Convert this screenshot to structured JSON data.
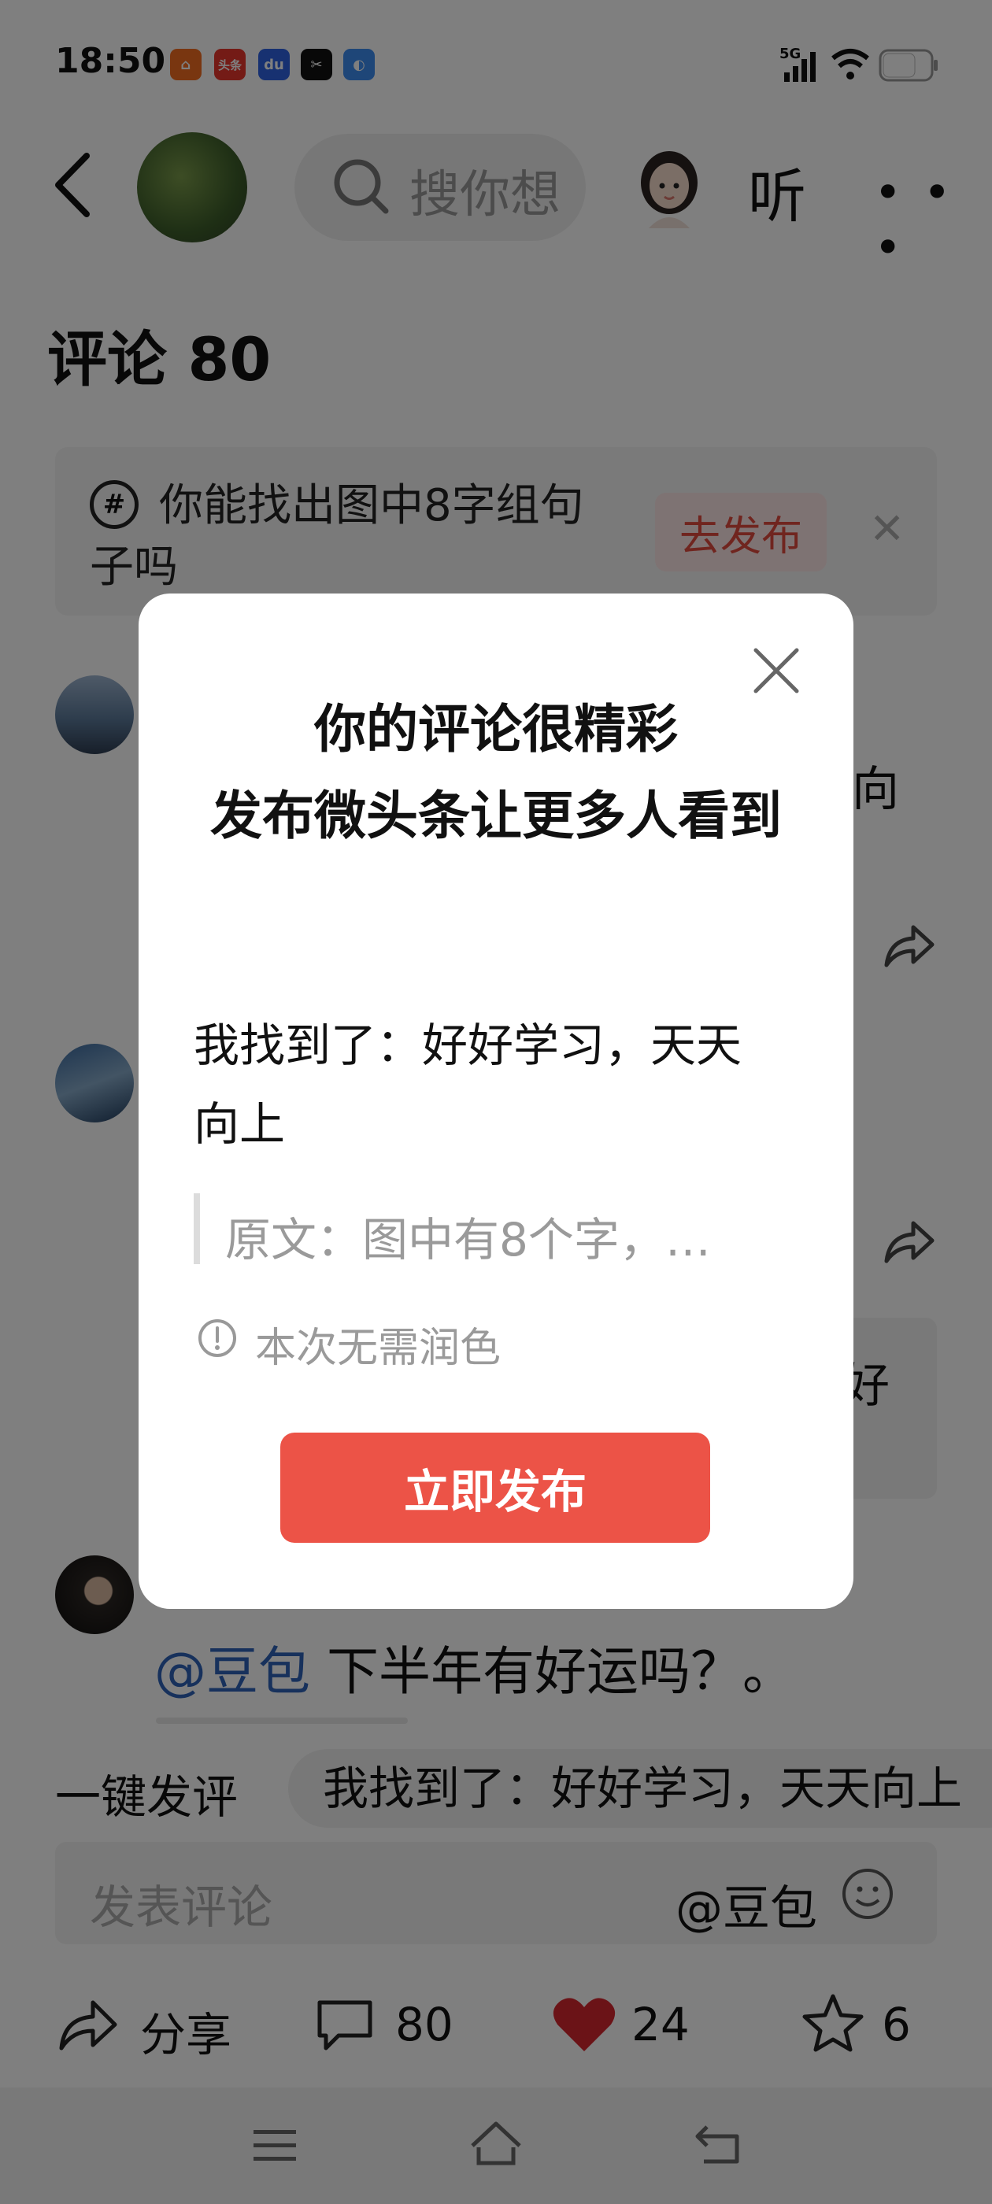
{
  "status_bar": {
    "time": "18:50",
    "network": "5G",
    "app_icons": [
      {
        "name": "orange-app-icon",
        "text": "",
        "color": "#f36d21"
      },
      {
        "name": "toutiao-app-icon",
        "text": "头条",
        "color": "#e8372c"
      },
      {
        "name": "baidu-app-icon",
        "text": "du",
        "color": "#2f63e3"
      },
      {
        "name": "capcut-app-icon",
        "text": "✂",
        "color": "#111111"
      },
      {
        "name": "files-app-icon",
        "text": "",
        "color": "#3c8cf0"
      }
    ]
  },
  "header": {
    "search_placeholder": "搜你想",
    "listen_label": "听"
  },
  "comments": {
    "title": "评论 80",
    "topic_card": {
      "text": "你能找出图中8字组句子吗",
      "publish_label": "去发布"
    },
    "fragment_1": "向",
    "fragment_2": "好",
    "doubao_mention": "@豆包",
    "doubao_text": " 下半年有好运吗？。"
  },
  "quick_comment": {
    "label": "一键发评",
    "chip_text": "我找到了：好好学习，天天向上"
  },
  "comment_input": {
    "placeholder": "发表评论",
    "at_label": "@豆包"
  },
  "action_bar": {
    "share_label": "分享",
    "comment_count": "80",
    "like_count": "24",
    "favorite_count": "6"
  },
  "dialog": {
    "title_line1": "你的评论很精彩",
    "title_line2": "发布微头条让更多人看到",
    "body": "我找到了：好好学习，天天向上",
    "quote": "原文：图中有8个字，…",
    "info": "本次无需润色",
    "publish_button": "立即发布"
  },
  "colors": {
    "accent_red": "#ec5347",
    "mention_blue": "#2e63b8",
    "like_red": "#d7262e"
  }
}
